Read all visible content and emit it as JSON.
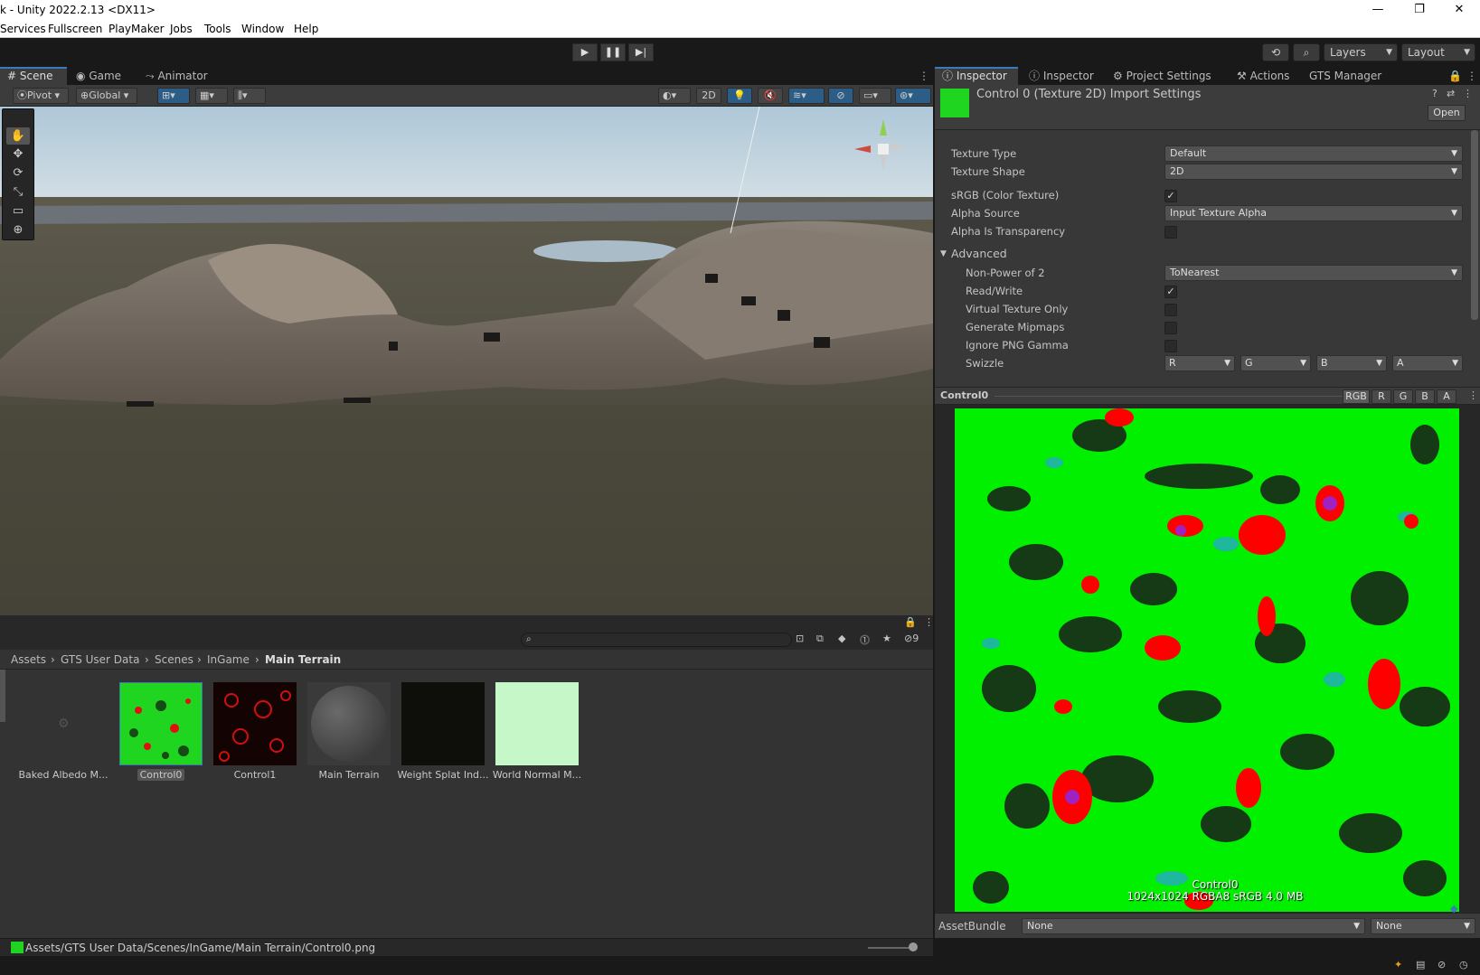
{
  "window": {
    "title": "k - Unity 2022.2.13 <DX11>",
    "minimize": "—",
    "maximize": "❐",
    "close": "✕"
  },
  "menu": [
    "Services",
    "Fullscreen",
    "PlayMaker",
    "Jobs",
    "Tools",
    "Window",
    "Help"
  ],
  "toolbar": {
    "layers": "Layers",
    "layout": "Layout",
    "history_icon": "history-icon",
    "search_icon": "search-icon"
  },
  "scene_tabs": [
    {
      "label": "Scene",
      "icon": "scene-icon"
    },
    {
      "label": "Game",
      "icon": "game-icon"
    },
    {
      "label": "Animator",
      "icon": "animator-icon"
    }
  ],
  "scene_toolbar": {
    "pivot": "Pivot",
    "global": "Global",
    "mode_2d": "2D"
  },
  "breadcrumb": [
    "Assets",
    "GTS User Data",
    "Scenes",
    "InGame",
    "Main Terrain"
  ],
  "hidden_count": "9",
  "assets": [
    {
      "label": "Baked Albedo M...",
      "selected": false
    },
    {
      "label": "Control0",
      "selected": true
    },
    {
      "label": "Control1",
      "selected": false
    },
    {
      "label": "Main Terrain",
      "selected": false
    },
    {
      "label": "Weight Splat Ind...",
      "selected": false
    },
    {
      "label": "World Normal M...",
      "selected": false
    }
  ],
  "project_status_path": "Assets/GTS User Data/Scenes/InGame/Main Terrain/Control0.png",
  "inspector": {
    "tabs": [
      "Inspector",
      "Inspector",
      "Project Settings",
      "Actions",
      "GTS Manager"
    ],
    "title": "Control 0 (Texture 2D) Import Settings",
    "open_label": "Open",
    "texture_type": {
      "label": "Texture Type",
      "value": "Default"
    },
    "texture_shape": {
      "label": "Texture Shape",
      "value": "2D"
    },
    "srgb": {
      "label": "sRGB (Color Texture)",
      "checked": true
    },
    "alpha_source": {
      "label": "Alpha Source",
      "value": "Input Texture Alpha"
    },
    "alpha_transparency": {
      "label": "Alpha Is Transparency",
      "checked": false
    },
    "advanced_label": "Advanced",
    "non_power_of_2": {
      "label": "Non-Power of 2",
      "value": "ToNearest"
    },
    "read_write": {
      "label": "Read/Write",
      "checked": true
    },
    "virtual_texture": {
      "label": "Virtual Texture Only",
      "checked": false
    },
    "generate_mipmaps": {
      "label": "Generate Mipmaps",
      "checked": false
    },
    "ignore_png_gamma": {
      "label": "Ignore PNG Gamma",
      "checked": false
    },
    "swizzle": {
      "label": "Swizzle",
      "values": [
        "R",
        "G",
        "B",
        "A"
      ]
    },
    "preview": {
      "name": "Control0",
      "channels": [
        "RGB",
        "R",
        "G",
        "B",
        "A"
      ],
      "info_name": "Control0",
      "info_details": "1024x1024  RGBA8 sRGB   4.0 MB"
    },
    "assetbundle": {
      "label": "AssetBundle",
      "name": "None",
      "variant": "None"
    }
  },
  "colors": {
    "accent": "#3a79bb",
    "panel": "#383838",
    "green": "#00ff00",
    "red": "#ff0000"
  }
}
